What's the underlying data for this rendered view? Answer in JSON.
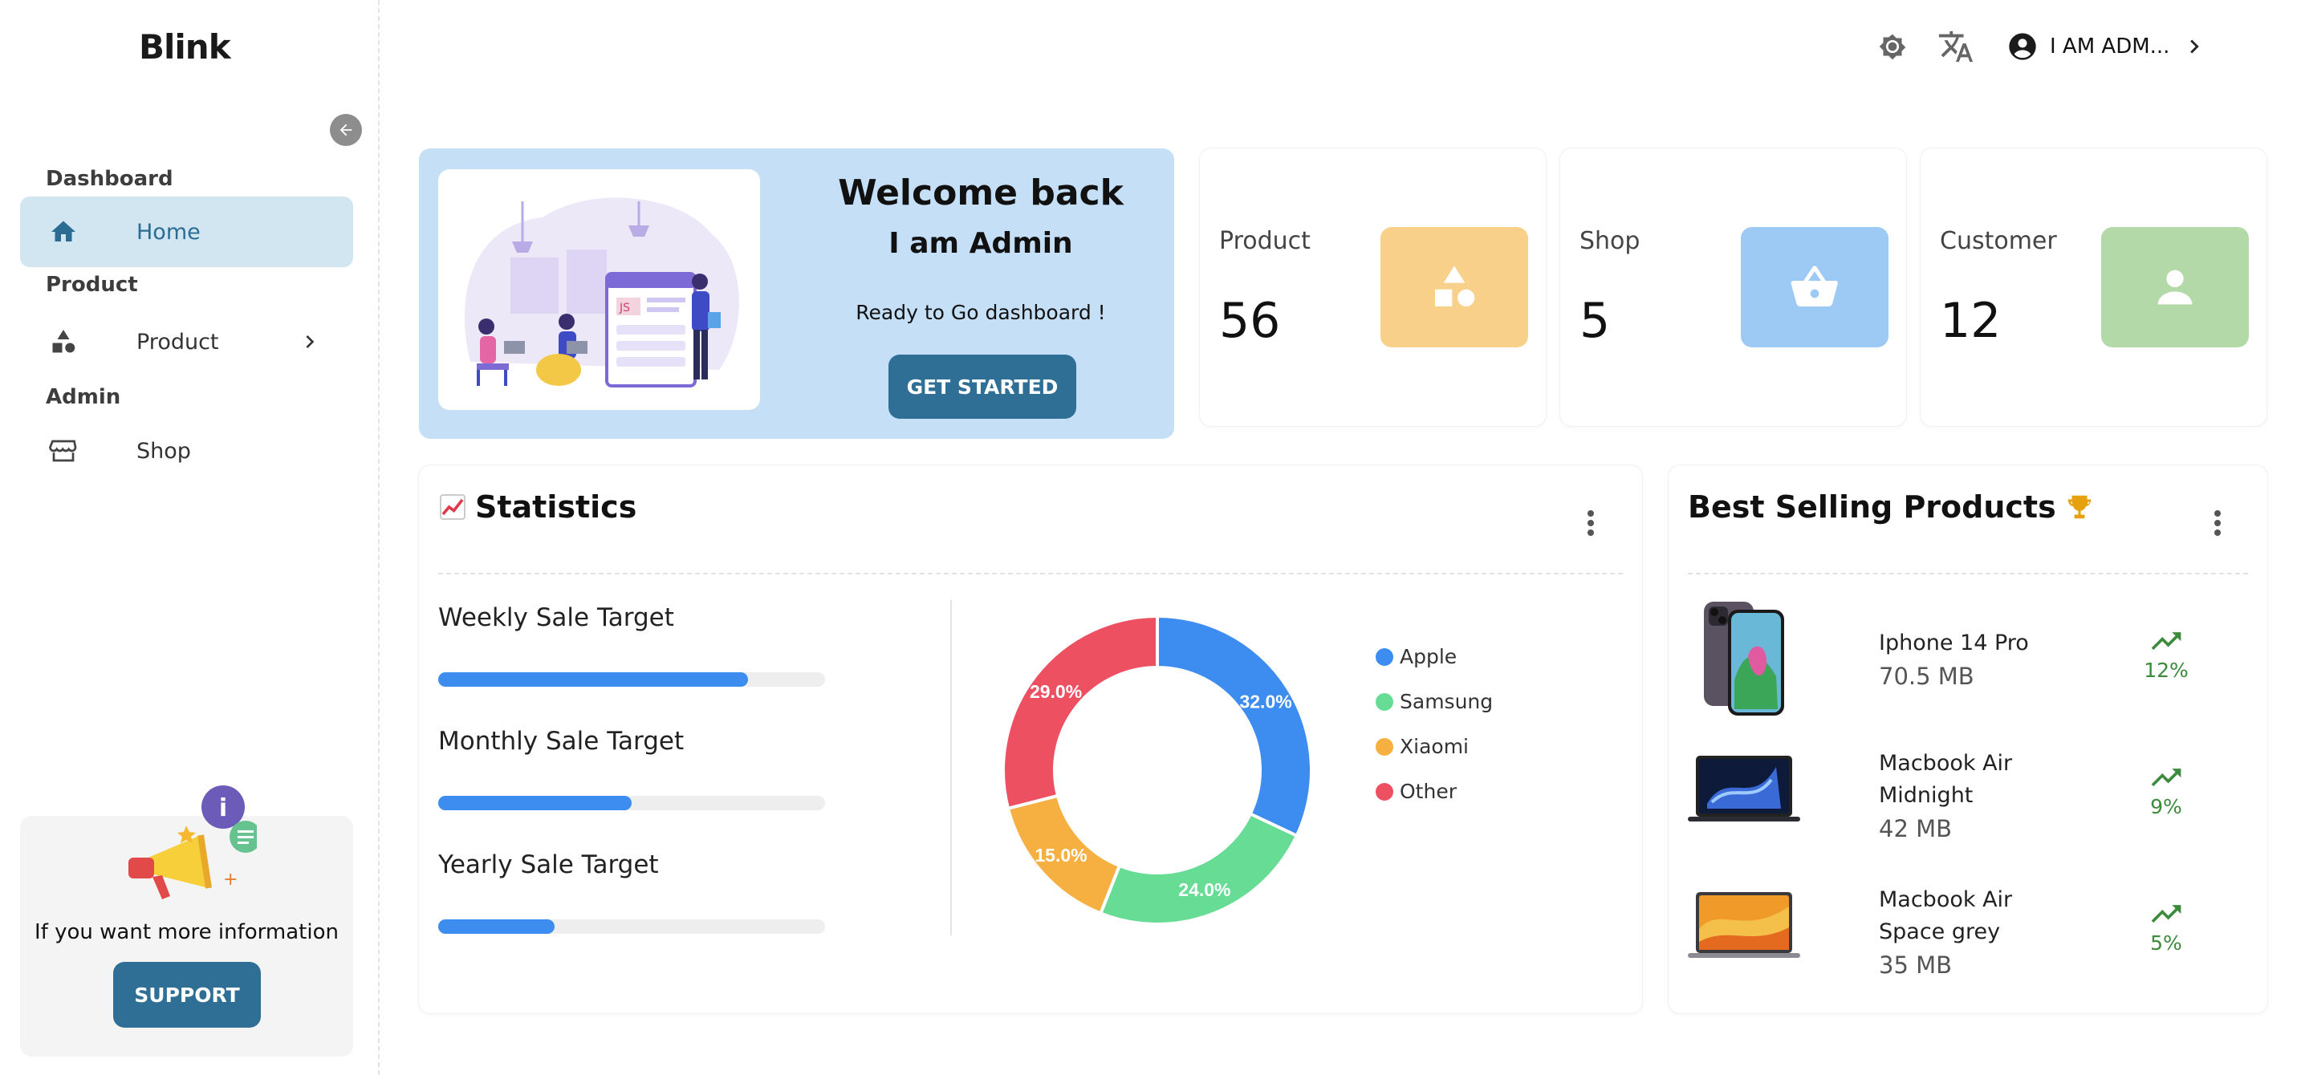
{
  "app": {
    "name": "Blink"
  },
  "header": {
    "user_name": "I AM ADM..."
  },
  "sidebar": {
    "sections": [
      {
        "label": "Dashboard"
      },
      {
        "label": "Product"
      },
      {
        "label": "Admin"
      }
    ],
    "items": [
      {
        "label": "Home",
        "icon": "home-icon",
        "active": true
      },
      {
        "label": "Product",
        "icon": "shapes-icon",
        "has_submenu": true
      },
      {
        "label": "Shop",
        "icon": "store-icon"
      }
    ],
    "support": {
      "text": "If you want more information",
      "button": "SUPPORT"
    }
  },
  "welcome": {
    "title": "Welcome back",
    "subtitle": "I am Admin",
    "description": "Ready to Go dashboard !",
    "button": "GET STARTED"
  },
  "stats": [
    {
      "label": "Product",
      "value": "56",
      "color": "#f8d08a"
    },
    {
      "label": "Shop",
      "value": "5",
      "color": "#9ccaf4"
    },
    {
      "label": "Customer",
      "value": "12",
      "color": "#b3d9a9"
    }
  ],
  "statistics": {
    "title": "Statistics",
    "targets": [
      {
        "label": "Weekly Sale Target",
        "progress": 0.8
      },
      {
        "label": "Monthly Sale Target",
        "progress": 0.5
      },
      {
        "label": "Yearly Sale Target",
        "progress": 0.3
      }
    ]
  },
  "chart_data": {
    "type": "pie",
    "categories": [
      "Apple",
      "Samsung",
      "Xiaomi",
      "Other"
    ],
    "values": [
      32.0,
      24.0,
      15.0,
      29.0
    ],
    "labels": [
      "32.0%",
      "24.0%",
      "15.0%",
      "29.0%"
    ],
    "colors": [
      "#3d8cef",
      "#66dc95",
      "#f5b041",
      "#ec5061"
    ],
    "donut": true,
    "legend": "right"
  },
  "best_selling": {
    "title": "Best Selling Products",
    "products": [
      {
        "name": "Iphone 14 Pro",
        "size": "70.5 MB",
        "growth": "12%"
      },
      {
        "name": "Macbook Air Midnight",
        "size": "42 MB",
        "growth": "9%"
      },
      {
        "name": "Macbook Air Space grey",
        "size": "35 MB",
        "growth": "5%"
      }
    ]
  }
}
